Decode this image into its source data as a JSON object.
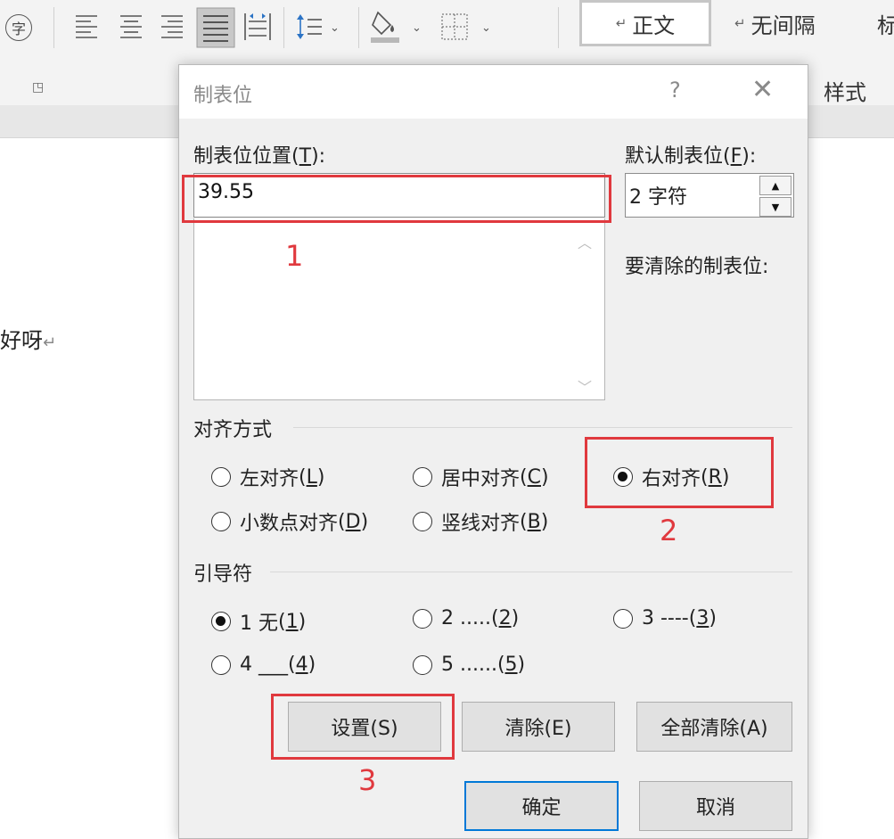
{
  "ribbon": {
    "char_border_glyph": "字",
    "icons": [
      "align-left-icon",
      "align-center-icon",
      "align-right-icon",
      "justify-icon",
      "distributed-icon",
      "line-spacing-icon",
      "shading-icon",
      "borders-icon"
    ],
    "styles": {
      "normal": "正文",
      "no_spacing": "无间隔",
      "next_partial": "标",
      "group_label": "样式"
    }
  },
  "document": {
    "text": "好呀",
    "para_mark": "↵"
  },
  "dialog": {
    "title": "制表位",
    "help": "?",
    "close": "✕",
    "tab_position_label": "制表位位置",
    "tab_position_key": "T",
    "tab_position_value": "39.55",
    "default_tab_label": "默认制表位",
    "default_tab_key": "F",
    "default_tab_value": "2 字符",
    "clear_label": "要清除的制表位:",
    "alignment": {
      "label": "对齐方式",
      "options": [
        {
          "text": "左对齐",
          "key": "L",
          "checked": false
        },
        {
          "text": "居中对齐",
          "key": "C",
          "checked": false
        },
        {
          "text": "右对齐",
          "key": "R",
          "checked": true
        },
        {
          "text": "小数点对齐",
          "key": "D",
          "checked": false
        },
        {
          "text": "竖线对齐",
          "key": "B",
          "checked": false
        }
      ]
    },
    "leader": {
      "label": "引导符",
      "options": [
        {
          "text": "1 无",
          "key": "1",
          "checked": true
        },
        {
          "text": "2 .....",
          "key": "2",
          "checked": false
        },
        {
          "text": "3 ----",
          "key": "3",
          "checked": false
        },
        {
          "text": "4 ___",
          "key": "4",
          "checked": false
        },
        {
          "text": "5 ......",
          "key": "5",
          "checked": false
        }
      ]
    },
    "buttons": {
      "set": "设置(S)",
      "clear": "清除(E)",
      "clear_all": "全部清除(A)",
      "ok": "确定",
      "cancel": "取消"
    }
  },
  "annotations": {
    "one": "1",
    "two": "2",
    "three": "3",
    "color": "#e0393e"
  }
}
